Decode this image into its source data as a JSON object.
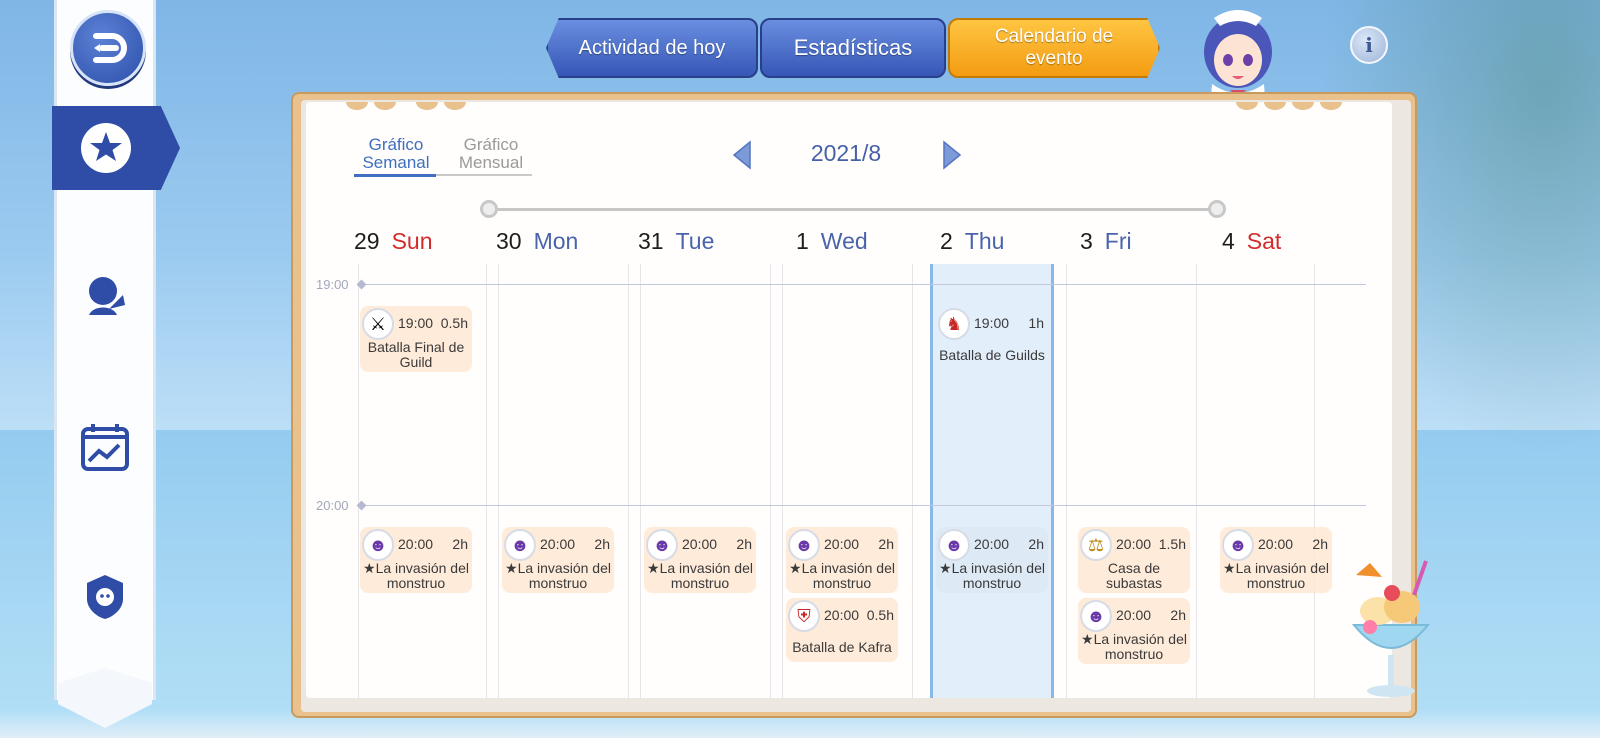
{
  "tabs": {
    "today": "Actividad de hoy",
    "stats": "Estadísticas",
    "calendar": "Calendario de evento"
  },
  "sidebar": {
    "icons": [
      "back-arrow-icon",
      "star-icon",
      "head-arrow-icon",
      "calendar-chart-icon",
      "guild-emblem-icon"
    ]
  },
  "calendar": {
    "view_tabs": {
      "weekly": "Gráfico Semanal",
      "monthly": "Gráfico Mensual",
      "selected": "weekly"
    },
    "month": "2021/8",
    "days": [
      {
        "num": "29",
        "name": "Sun",
        "weekend": true
      },
      {
        "num": "30",
        "name": "Mon",
        "weekend": false
      },
      {
        "num": "31",
        "name": "Tue",
        "weekend": false
      },
      {
        "num": "1",
        "name": "Wed",
        "weekend": false
      },
      {
        "num": "2",
        "name": "Thu",
        "weekend": false,
        "today": true
      },
      {
        "num": "3",
        "name": "Fri",
        "weekend": false
      },
      {
        "num": "4",
        "name": "Sat",
        "weekend": true
      }
    ],
    "time_labels": [
      "19:00",
      "20:00"
    ],
    "events": [
      {
        "day": 0,
        "time": "19:00",
        "dur": "0.5h",
        "name": "Batalla Final de Guild",
        "icon": "crossed-swords-icon"
      },
      {
        "day": 4,
        "time": "19:00",
        "dur": "1h",
        "name": "Batalla de Guilds",
        "icon": "guild-dragon-icon"
      },
      {
        "day": 0,
        "time": "20:00",
        "dur": "2h",
        "name": "★La invasión del monstruo",
        "icon": "monster-icon"
      },
      {
        "day": 1,
        "time": "20:00",
        "dur": "2h",
        "name": "★La invasión del monstruo",
        "icon": "monster-icon"
      },
      {
        "day": 2,
        "time": "20:00",
        "dur": "2h",
        "name": "★La invasión del monstruo",
        "icon": "monster-icon"
      },
      {
        "day": 3,
        "time": "20:00",
        "dur": "2h",
        "name": "★La invasión del monstruo",
        "icon": "monster-icon"
      },
      {
        "day": 3,
        "time": "20:00",
        "dur": "0.5h",
        "name": "Batalla de Kafra",
        "icon": "kafra-shield-icon"
      },
      {
        "day": 4,
        "time": "20:00",
        "dur": "2h",
        "name": "★La invasión del monstruo",
        "icon": "monster-icon"
      },
      {
        "day": 5,
        "time": "20:00",
        "dur": "1.5h",
        "name": "Casa de subastas",
        "icon": "auction-icon"
      },
      {
        "day": 5,
        "time": "20:00",
        "dur": "2h",
        "name": "★La invasión del monstruo",
        "icon": "monster-icon"
      },
      {
        "day": 6,
        "time": "20:00",
        "dur": "2h",
        "name": "★La invasión del monstruo",
        "icon": "monster-icon"
      }
    ]
  },
  "colors": {
    "accent_blue": "#3657b6",
    "accent_orange": "#f39c12",
    "weekend_red": "#d22c2c",
    "weekday_blue": "#4a64ac",
    "event_bg": "#ffe8d2"
  }
}
